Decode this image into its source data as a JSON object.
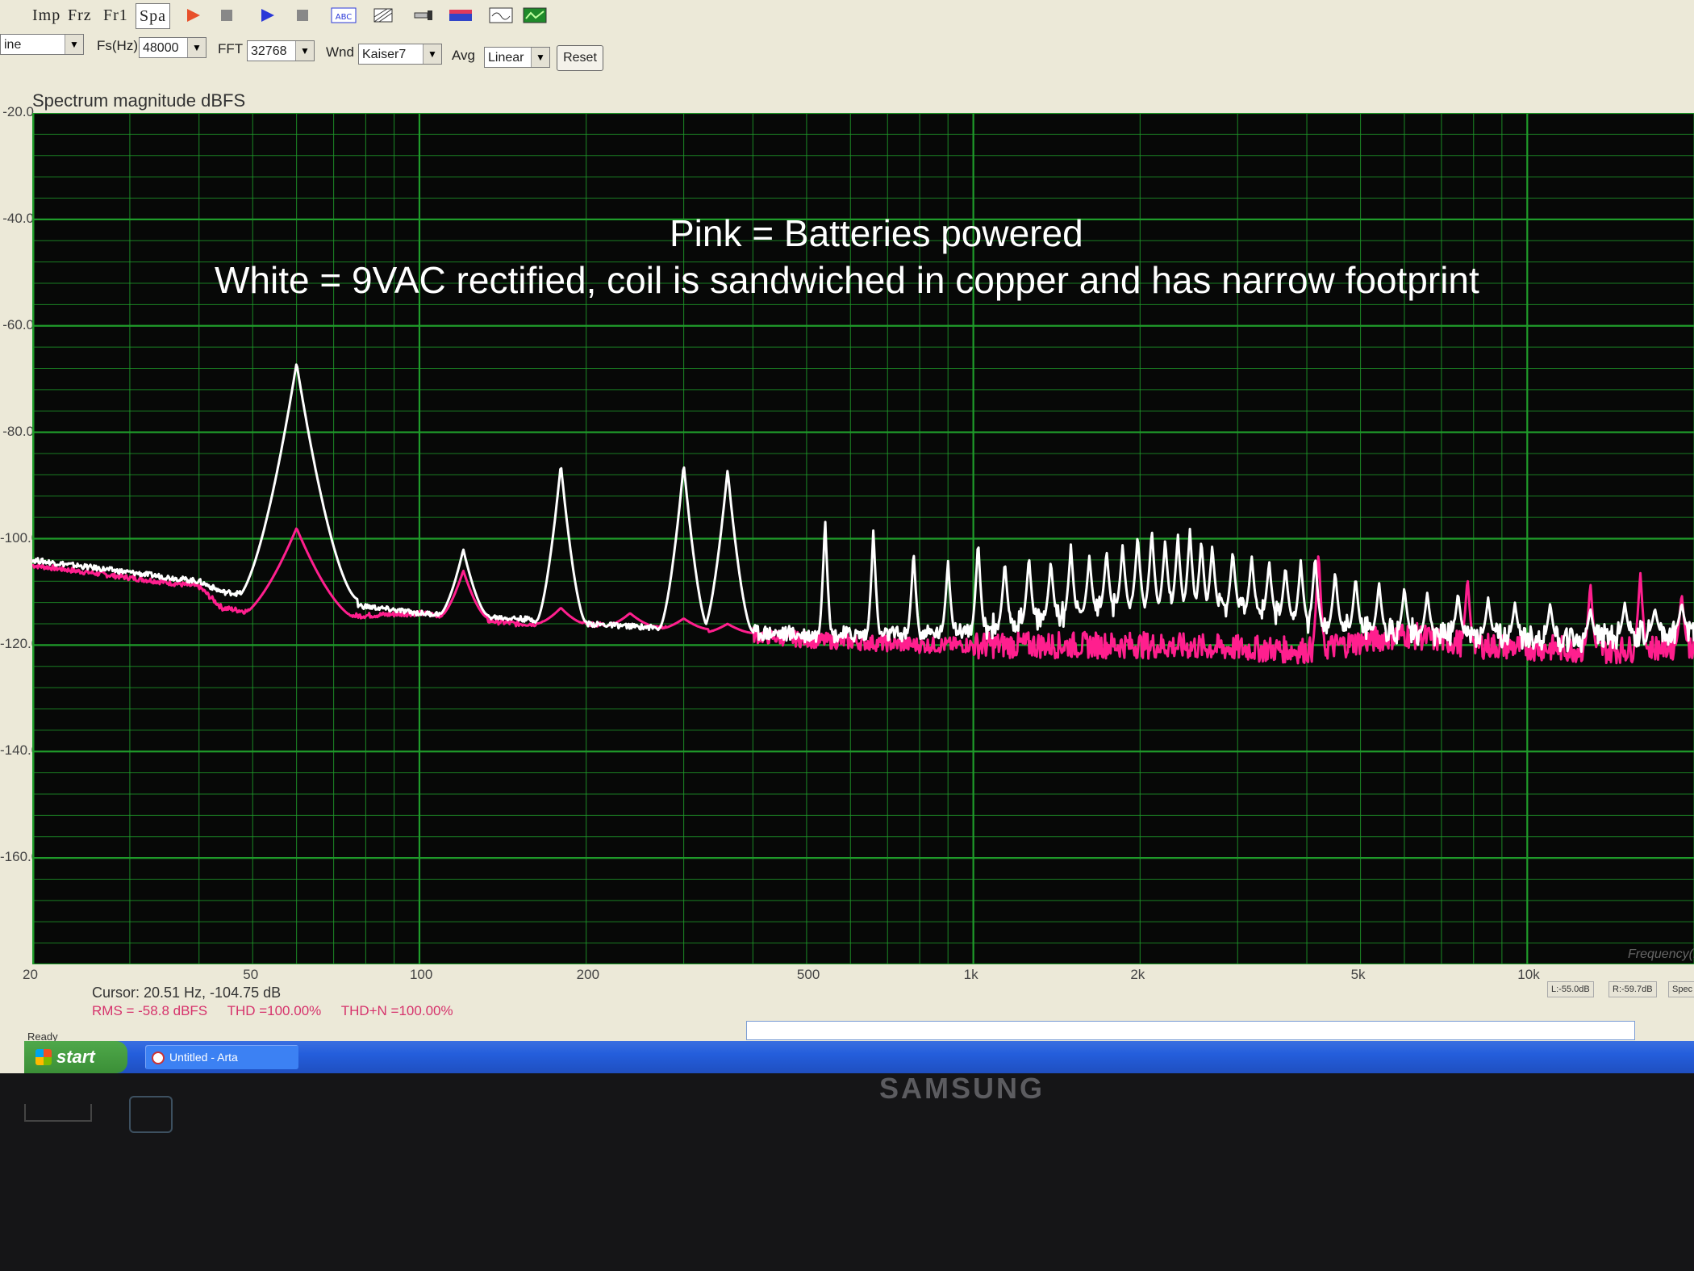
{
  "toolbar": {
    "mode_buttons": [
      "Imp",
      "Frz",
      "Fr1",
      "Spa"
    ],
    "active_mode": "Spa"
  },
  "settings": {
    "signal": "ine",
    "fs_label": "Fs(Hz)",
    "fs_value": "48000",
    "fft_label": "FFT",
    "fft_value": "32768",
    "wnd_label": "Wnd",
    "wnd_value": "Kaiser7",
    "avg_label": "Avg",
    "avg_value": "Linear",
    "reset_label": "Reset"
  },
  "annotation": {
    "line1": "Pink = Batteries powered",
    "line2": "White = 9VAC rectified, coil is sandwiched in copper and has narrow footprint"
  },
  "readout": {
    "cursor": "Cursor: 20.51 Hz, -104.75 dB",
    "rms": "RMS = -58.8 dBFS",
    "thd": "THD =100.00%",
    "thdn": "THD+N =100.00%",
    "l_level": "L:-55.0dB",
    "r_level": "R:-59.7dB",
    "spec": "Spec"
  },
  "status": {
    "ready": "Ready",
    "start": "start",
    "task": "Untitled - Arta"
  },
  "monitor": {
    "brand": "SAMSUNG"
  },
  "colors": {
    "pink": "#ff1f8e",
    "white": "#ffffff",
    "grid": "#1f9b2a",
    "plot_bg": "#070807"
  },
  "chart_data": {
    "type": "line",
    "title": "Spectrum magnitude dBFS",
    "xlabel": "Frequency(H",
    "ylabel": "",
    "xscale": "log",
    "xlim": [
      20,
      20000
    ],
    "ylim": [
      -180,
      -20
    ],
    "yticks": [
      "-20.0",
      "-40.0",
      "-60.0",
      "-80.0",
      "-100.0",
      "-120.0",
      "-140.0",
      "-160.0"
    ],
    "xticks": [
      {
        "v": 20,
        "label": "20"
      },
      {
        "v": 50,
        "label": "50"
      },
      {
        "v": 100,
        "label": "100"
      },
      {
        "v": 200,
        "label": "200"
      },
      {
        "v": 500,
        "label": "500"
      },
      {
        "v": 1000,
        "label": "1k"
      },
      {
        "v": 2000,
        "label": "2k"
      },
      {
        "v": 5000,
        "label": "5k"
      },
      {
        "v": 10000,
        "label": "10k"
      }
    ],
    "grid": true,
    "series": [
      {
        "name": "Pink = Batteries powered",
        "color": "#ff1f8e",
        "floor": [
          [
            20,
            -105
          ],
          [
            40,
            -109
          ],
          [
            44,
            -113
          ],
          [
            60,
            -115
          ],
          [
            100,
            -114
          ],
          [
            150,
            -116
          ],
          [
            200,
            -116
          ],
          [
            300,
            -117
          ],
          [
            500,
            -119
          ],
          [
            800,
            -120
          ],
          [
            1000,
            -120
          ],
          [
            2000,
            -120
          ],
          [
            4000,
            -121
          ],
          [
            6000,
            -118
          ],
          [
            8000,
            -120
          ],
          [
            14000,
            -121
          ],
          [
            20000,
            -120
          ]
        ],
        "peaks": [
          [
            60,
            -98
          ],
          [
            120,
            -106
          ],
          [
            180,
            -113
          ],
          [
            240,
            -114
          ],
          [
            300,
            -115
          ],
          [
            360,
            -116
          ],
          [
            4200,
            -102
          ],
          [
            7800,
            -107
          ],
          [
            13000,
            -108
          ],
          [
            16000,
            -106
          ],
          [
            19000,
            -110
          ]
        ]
      },
      {
        "name": "White = 9VAC rectified, coil is sandwiched in copper and has narrow footprint",
        "color": "#ffffff",
        "floor": [
          [
            20,
            -104
          ],
          [
            40,
            -108
          ],
          [
            44,
            -110
          ],
          [
            70,
            -112
          ],
          [
            100,
            -114
          ],
          [
            150,
            -115
          ],
          [
            200,
            -116
          ],
          [
            300,
            -117
          ],
          [
            500,
            -118
          ],
          [
            800,
            -118
          ],
          [
            1000,
            -117
          ],
          [
            2000,
            -112
          ],
          [
            3000,
            -113
          ],
          [
            5000,
            -117
          ],
          [
            8000,
            -118
          ],
          [
            12000,
            -119
          ],
          [
            20000,
            -117
          ]
        ],
        "peaks": [
          [
            60,
            -67
          ],
          [
            120,
            -102
          ],
          [
            180,
            -86
          ],
          [
            300,
            -86
          ],
          [
            360,
            -87
          ],
          [
            540,
            -96
          ],
          [
            660,
            -98
          ],
          [
            780,
            -102
          ],
          [
            900,
            -104
          ],
          [
            1020,
            -100
          ],
          [
            1140,
            -104
          ],
          [
            1260,
            -103
          ],
          [
            1380,
            -104
          ],
          [
            1500,
            -101
          ],
          [
            1620,
            -103
          ],
          [
            1740,
            -102
          ],
          [
            1860,
            -101
          ],
          [
            1980,
            -99
          ],
          [
            2100,
            -98
          ],
          [
            2220,
            -100
          ],
          [
            2340,
            -99
          ],
          [
            2460,
            -98
          ],
          [
            2580,
            -100
          ],
          [
            2700,
            -101
          ],
          [
            2940,
            -102
          ],
          [
            3180,
            -103
          ],
          [
            3420,
            -104
          ],
          [
            3660,
            -105
          ],
          [
            3900,
            -104
          ],
          [
            4140,
            -103
          ],
          [
            4500,
            -106
          ],
          [
            4900,
            -107
          ],
          [
            5400,
            -108
          ],
          [
            6000,
            -109
          ],
          [
            6600,
            -110
          ],
          [
            7500,
            -110
          ],
          [
            8500,
            -111
          ],
          [
            9500,
            -112
          ],
          [
            11000,
            -112
          ],
          [
            13000,
            -113
          ],
          [
            15000,
            -112
          ],
          [
            17000,
            -113
          ],
          [
            19000,
            -112
          ]
        ]
      }
    ]
  }
}
